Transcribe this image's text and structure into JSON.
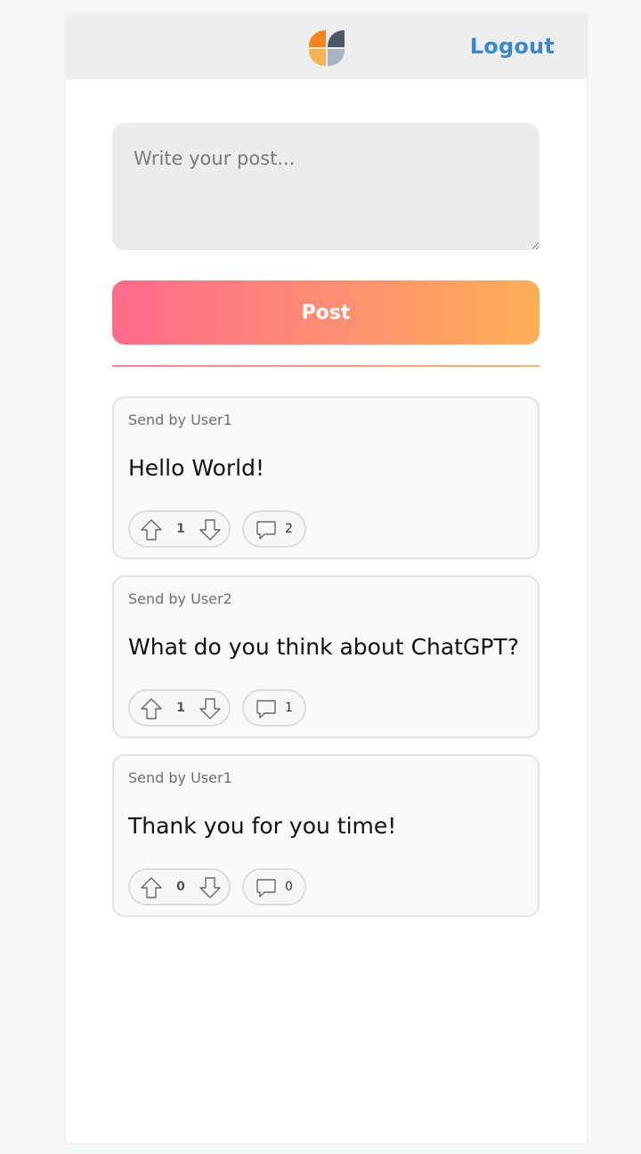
{
  "header": {
    "logout_label": "Logout",
    "logo_colors": [
      "#f7841f",
      "#4d5866",
      "#fbb255",
      "#a5b4c0"
    ]
  },
  "composer": {
    "placeholder": "Write your post...",
    "value": ""
  },
  "post_button": {
    "label": "Post",
    "gradient": [
      "#ff6a8a",
      "#fdae55"
    ]
  },
  "posts": [
    {
      "author": "Send by User1",
      "content": "Hello World!",
      "votes": "1",
      "comments": "2"
    },
    {
      "author": "Send by User2",
      "content": "What do you think about ChatGPT?",
      "votes": "1",
      "comments": "1"
    },
    {
      "author": "Send by User1",
      "content": "Thank you for you time!",
      "votes": "0",
      "comments": "0"
    }
  ],
  "icons": {
    "upvote": "arrow-up-icon",
    "downvote": "arrow-down-icon",
    "comment": "comment-icon",
    "logo": "logo-icon"
  }
}
